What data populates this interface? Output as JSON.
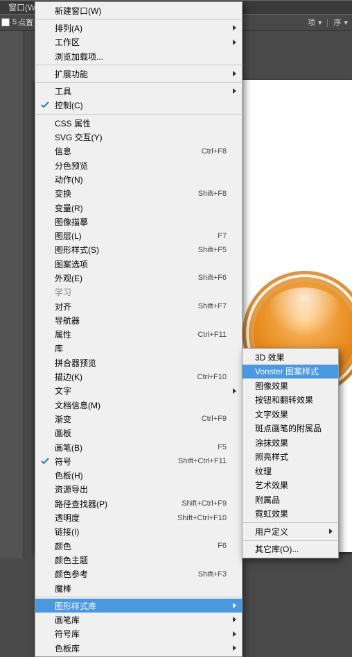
{
  "menubar": {
    "window_label": "窗口(W)"
  },
  "optionsbar": {
    "stroke_value": "5",
    "unit_suffix": "点置"
  },
  "hidden_bar": {
    "a": "项",
    "b": "序"
  },
  "menu_items": [
    {
      "label": "新建窗口(W)"
    },
    {
      "sep": true
    },
    {
      "label": "排列(A)",
      "submenu": true
    },
    {
      "label": "工作区",
      "submenu": true
    },
    {
      "label": "浏览加载项..."
    },
    {
      "sep": true
    },
    {
      "label": "扩展功能",
      "submenu": true
    },
    {
      "sep": true
    },
    {
      "label": "工具",
      "submenu": true
    },
    {
      "label": "控制(C)",
      "checked": true
    },
    {
      "sep": true
    },
    {
      "label": "CSS 属性"
    },
    {
      "label": "SVG 交互(Y)"
    },
    {
      "label": "信息",
      "shortcut": "Ctrl+F8"
    },
    {
      "label": "分色预览"
    },
    {
      "label": "动作(N)"
    },
    {
      "label": "变换",
      "shortcut": "Shift+F8"
    },
    {
      "label": "变量(R)"
    },
    {
      "label": "图像描摹"
    },
    {
      "label": "图层(L)",
      "shortcut": "F7"
    },
    {
      "label": "图形样式(S)",
      "shortcut": "Shift+F5"
    },
    {
      "label": "图案选项"
    },
    {
      "label": "外观(E)",
      "shortcut": "Shift+F6"
    },
    {
      "label": "学习",
      "disabled": true
    },
    {
      "label": "对齐",
      "shortcut": "Shift+F7"
    },
    {
      "label": "导航器"
    },
    {
      "label": "属性",
      "shortcut": "Ctrl+F11"
    },
    {
      "label": "库"
    },
    {
      "label": "拼合器预览"
    },
    {
      "label": "描边(K)",
      "shortcut": "Ctrl+F10"
    },
    {
      "label": "文字",
      "submenu": true
    },
    {
      "label": "文档信息(M)"
    },
    {
      "label": "渐变",
      "shortcut": "Ctrl+F9"
    },
    {
      "label": "画板"
    },
    {
      "label": "画笔(B)",
      "shortcut": "F5"
    },
    {
      "label": "符号",
      "checked": true,
      "shortcut": "Shift+Ctrl+F11"
    },
    {
      "label": "色板(H)"
    },
    {
      "label": "资源导出"
    },
    {
      "label": "路径查找器(P)",
      "shortcut": "Shift+Ctrl+F9"
    },
    {
      "label": "透明度",
      "shortcut": "Shift+Ctrl+F10"
    },
    {
      "label": "链接(I)"
    },
    {
      "label": "颜色",
      "shortcut": "F6"
    },
    {
      "label": "颜色主题"
    },
    {
      "label": "颜色参考",
      "shortcut": "Shift+F3"
    },
    {
      "label": "魔棒"
    },
    {
      "sep": true
    },
    {
      "label": "图形样式库",
      "submenu": true,
      "highlighted": true
    },
    {
      "label": "画笔库",
      "submenu": true
    },
    {
      "label": "符号库",
      "submenu": true
    },
    {
      "label": "色板库",
      "submenu": true
    }
  ],
  "submenu_items": [
    {
      "label": "3D 效果"
    },
    {
      "label": "Vonster 图案样式",
      "highlighted": true
    },
    {
      "label": "图像效果"
    },
    {
      "label": "按钮和翻转效果"
    },
    {
      "label": "文字效果"
    },
    {
      "label": "斑点画笔的附属品"
    },
    {
      "label": "涂抹效果"
    },
    {
      "label": "照亮样式"
    },
    {
      "label": "纹理"
    },
    {
      "label": "艺术效果"
    },
    {
      "label": "附属品"
    },
    {
      "label": "霓虹效果"
    },
    {
      "sep": true
    },
    {
      "label": "用户定义",
      "submenu": true
    },
    {
      "sep": true
    },
    {
      "label": "其它库(O)..."
    }
  ]
}
